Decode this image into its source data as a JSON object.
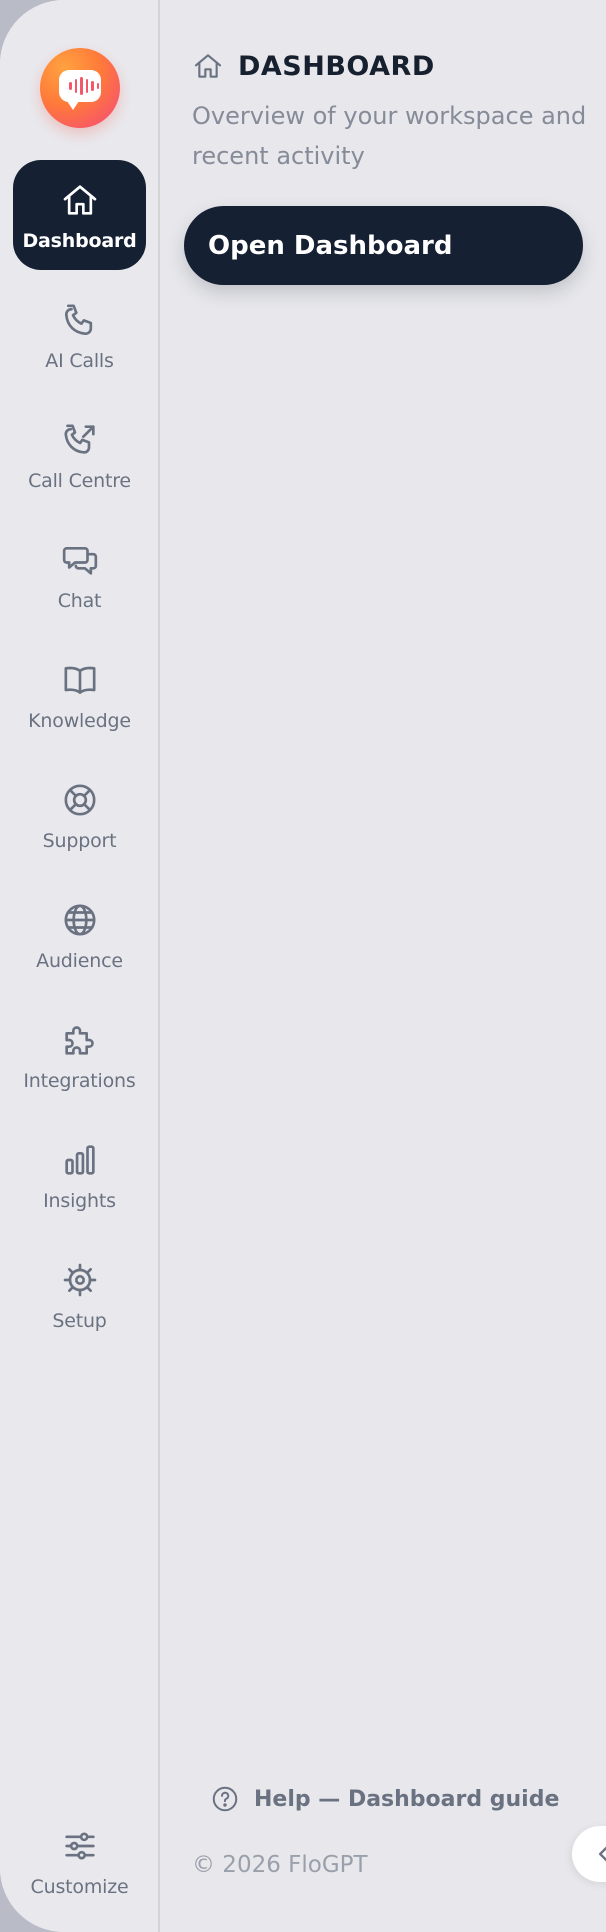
{
  "sidebar": {
    "items": [
      {
        "label": "Dashboard",
        "icon": "home-icon",
        "active": true
      },
      {
        "label": "AI Calls",
        "icon": "phone-icon"
      },
      {
        "label": "Call Centre",
        "icon": "phone-outgoing-icon"
      },
      {
        "label": "Chat",
        "icon": "chat-bubbles-icon"
      },
      {
        "label": "Knowledge",
        "icon": "book-icon"
      },
      {
        "label": "Support",
        "icon": "lifebuoy-icon"
      },
      {
        "label": "Audience",
        "icon": "globe-icon"
      },
      {
        "label": "Integrations",
        "icon": "puzzle-icon"
      },
      {
        "label": "Insights",
        "icon": "bar-chart-icon"
      },
      {
        "label": "Setup",
        "icon": "gear-icon"
      }
    ],
    "customize": {
      "label": "Customize",
      "icon": "sliders-icon"
    }
  },
  "header": {
    "title": "DASHBOARD",
    "subtitle": "Overview of your workspace and recent activity"
  },
  "main": {
    "open_button": "Open Dashboard"
  },
  "footer": {
    "help": "Help — Dashboard guide",
    "copyright": "© 2026 FloGPT"
  },
  "colors": {
    "accent_dark": "#152033",
    "logo_gradient": [
      "#ffa23f",
      "#f4467d"
    ],
    "muted_text": "#6a7282"
  }
}
